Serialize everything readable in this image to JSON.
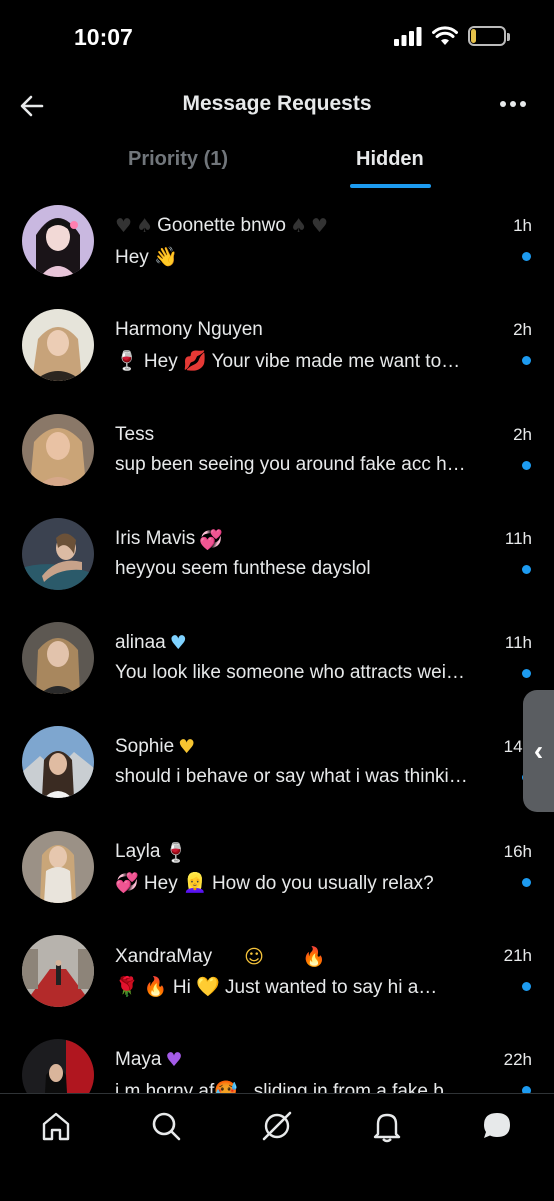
{
  "status": {
    "time": "10:07",
    "battery": "15",
    "battery_level": 0.15
  },
  "header": {
    "title": "Message Requests"
  },
  "tabs": [
    {
      "label": "Priority (1)",
      "active": false
    },
    {
      "label": "Hidden",
      "active": true
    }
  ],
  "messages": [
    {
      "name": "Goonette bnwo",
      "time": "1h",
      "preview": "Hey 👋"
    },
    {
      "name": "Harmony Nguyen",
      "time": "2h",
      "preview": "🍷 Hey 💋 Your vibe made me want to…"
    },
    {
      "name": "Tess",
      "time": "2h",
      "preview": "sup been seeing you around fake acc h…"
    },
    {
      "name": "Iris Mavis",
      "time": "11h",
      "preview": "heyyou seem funthese dayslol"
    },
    {
      "name": "alinaa",
      "time": "11h",
      "preview": "You look like someone who attracts wei…"
    },
    {
      "name": "Sophie",
      "time": "14h",
      "preview": "should i behave or say what i was thinki…"
    },
    {
      "name": "Layla",
      "time": "16h",
      "preview": "💞 Hey 👱‍♀️ How do you usually relax?"
    },
    {
      "name": "XandraMay",
      "time": "21h",
      "preview": "🌹      🔥 Hi 💛 Just wanted to say hi a…"
    },
    {
      "name": "Maya",
      "time": "22h",
      "preview": "i m horny af🥵 . sliding in from a fake b…"
    }
  ],
  "colors": {
    "accent": "#1d9bf0",
    "background": "#000000",
    "text": "#e7e9ea",
    "muted": "#71767b"
  },
  "nav": [
    "home-icon",
    "search-icon",
    "grok-icon",
    "notifications-icon",
    "messages-icon"
  ]
}
